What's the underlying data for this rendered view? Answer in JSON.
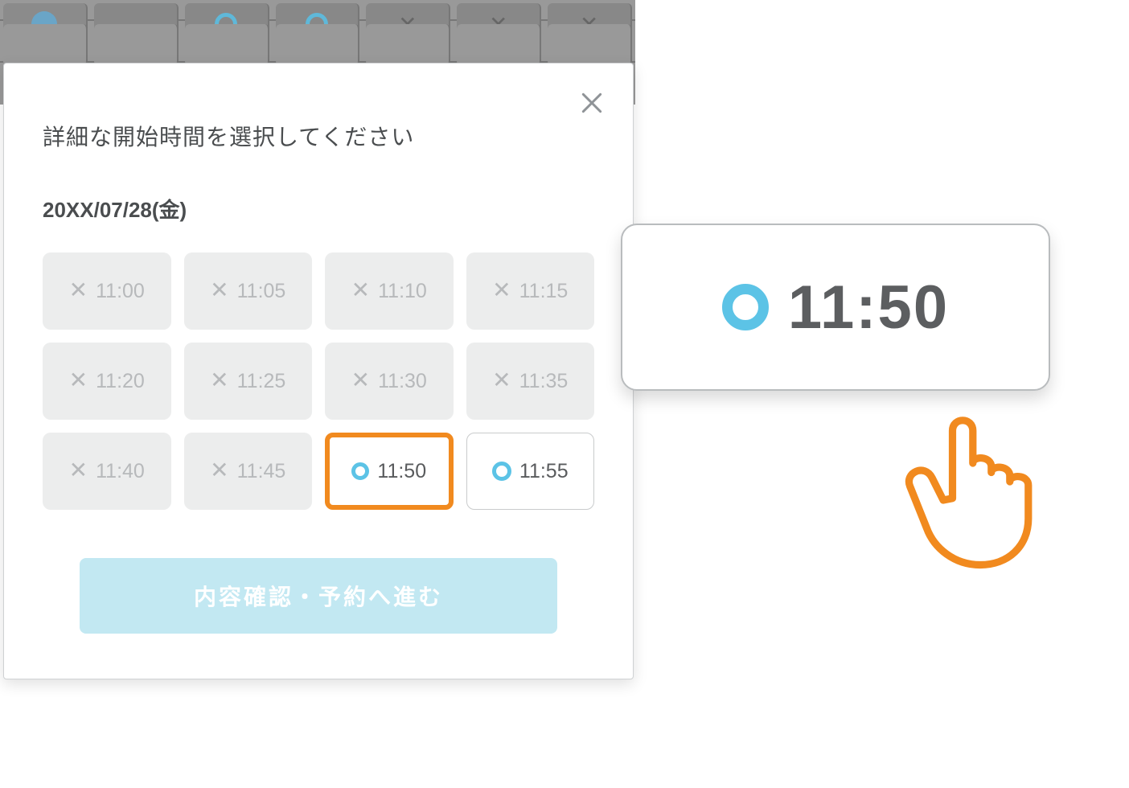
{
  "modal": {
    "title": "詳細な開始時間を選択してください",
    "date": "20XX/07/28(金)",
    "confirm_label": "内容確認・予約へ進む"
  },
  "slots": [
    {
      "time": "11:00",
      "status": "disabled"
    },
    {
      "time": "11:05",
      "status": "disabled"
    },
    {
      "time": "11:10",
      "status": "disabled"
    },
    {
      "time": "11:15",
      "status": "disabled"
    },
    {
      "time": "11:20",
      "status": "disabled"
    },
    {
      "time": "11:25",
      "status": "disabled"
    },
    {
      "time": "11:30",
      "status": "disabled"
    },
    {
      "time": "11:35",
      "status": "disabled"
    },
    {
      "time": "11:40",
      "status": "disabled"
    },
    {
      "time": "11:45",
      "status": "disabled"
    },
    {
      "time": "11:50",
      "status": "selected"
    },
    {
      "time": "11:55",
      "status": "available"
    }
  ],
  "callout": {
    "time": "11:50"
  },
  "colors": {
    "accent_orange": "#f18a1f",
    "accent_blue": "#5cc3e6",
    "button_bg": "#c2e8f2",
    "disabled_bg": "#eceded"
  }
}
